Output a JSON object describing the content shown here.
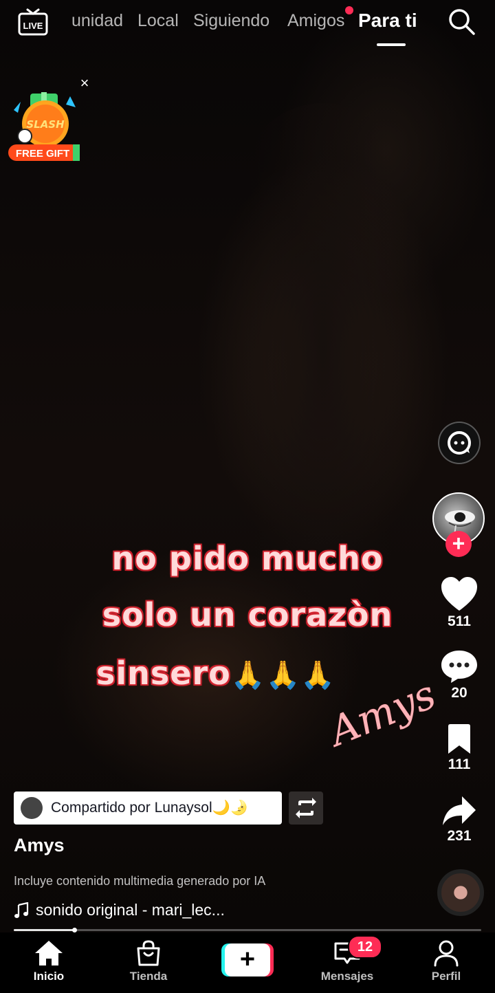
{
  "top_nav": {
    "live_label": "LIVE",
    "tabs": [
      {
        "label": "unidad",
        "active": false
      },
      {
        "label": "Local",
        "active": false
      },
      {
        "label": "Siguiendo",
        "active": false
      },
      {
        "label": "Amigos",
        "active": false,
        "has_notification_dot": true
      },
      {
        "label": "Para ti",
        "active": true
      }
    ],
    "search_icon": "search-icon"
  },
  "promo": {
    "brand_text": "SLASH",
    "label": "FREE GIFT",
    "close_glyph": "×"
  },
  "video_overlay": {
    "caption_line1": "no pido mucho",
    "caption_line2": "solo un corazòn",
    "caption_line3": "sinsero",
    "caption_emoji": "🙏🙏🙏",
    "watermark": "Amys"
  },
  "actions": {
    "likes": "511",
    "comments": "20",
    "saves": "111",
    "shares": "231",
    "follow_glyph": "+"
  },
  "post": {
    "shared_by": "Compartido por Lunaysol🌙🌛",
    "author": "Amys",
    "ai_disclosure": "Incluye contenido multimedia generado por IA",
    "sound": "sonido original - mari_lec...",
    "progress_fraction": 0.13
  },
  "bottom_nav": {
    "items": [
      {
        "label": "Inicio",
        "icon": "home-icon",
        "active": true
      },
      {
        "label": "Tienda",
        "icon": "shopping-bag-icon",
        "active": false
      },
      {
        "label": "",
        "icon": "create-plus-icon",
        "active": false
      },
      {
        "label": "Mensajes",
        "icon": "inbox-icon",
        "active": false
      },
      {
        "label": "Perfil",
        "icon": "profile-icon",
        "active": false
      }
    ],
    "messages_badge": "12",
    "create_glyph": "+"
  },
  "colors": {
    "accent": "#fe2c55",
    "cyan": "#25f4ee",
    "caption_stroke": "#c41e2a",
    "watermark": "#ffb3b8"
  }
}
